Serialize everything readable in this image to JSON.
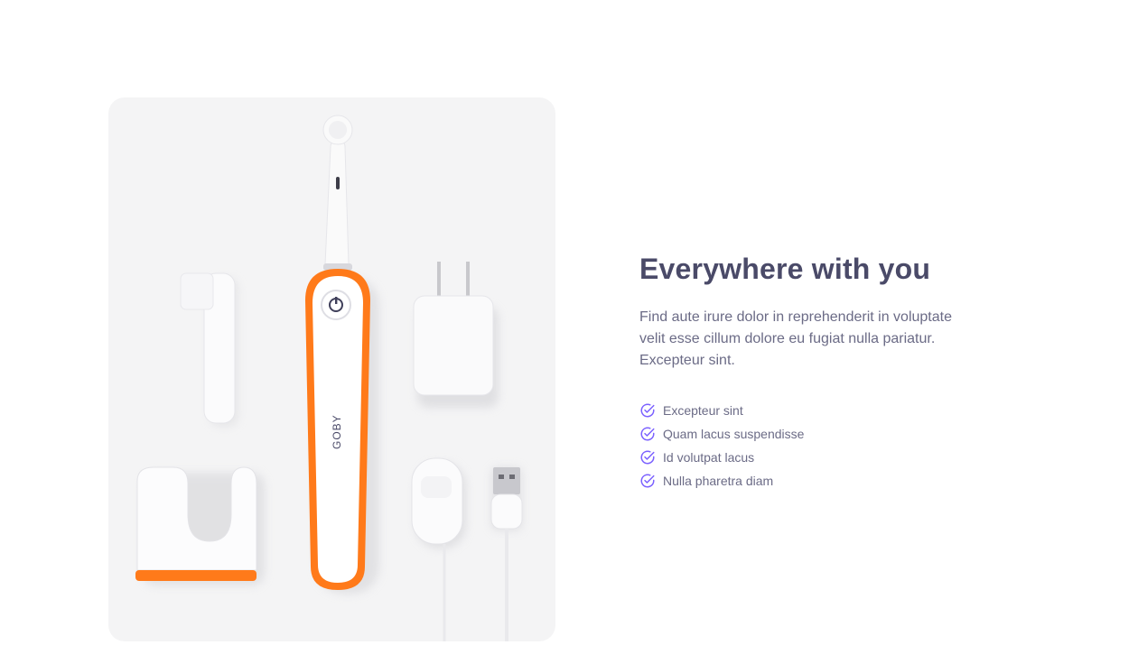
{
  "product_image": {
    "brand_text": "GOBY",
    "accent_color": "#ff7a1a"
  },
  "headline": "Everywhere with you",
  "description": "Find aute irure dolor in reprehenderit in voluptate velit esse cillum dolore eu fugiat nulla pariatur. Excepteur sint.",
  "features": [
    {
      "label": "Excepteur sint",
      "icon": "check-circle-icon"
    },
    {
      "label": "Quam lacus suspendisse",
      "icon": "check-circle-icon"
    },
    {
      "label": "Id volutpat lacus",
      "icon": "check-circle-icon"
    },
    {
      "label": "Nulla pharetra diam",
      "icon": "check-circle-icon"
    }
  ],
  "colors": {
    "check_icon": "#7b61ff",
    "heading": "#4a4a68",
    "body_text": "#6b6b86"
  }
}
